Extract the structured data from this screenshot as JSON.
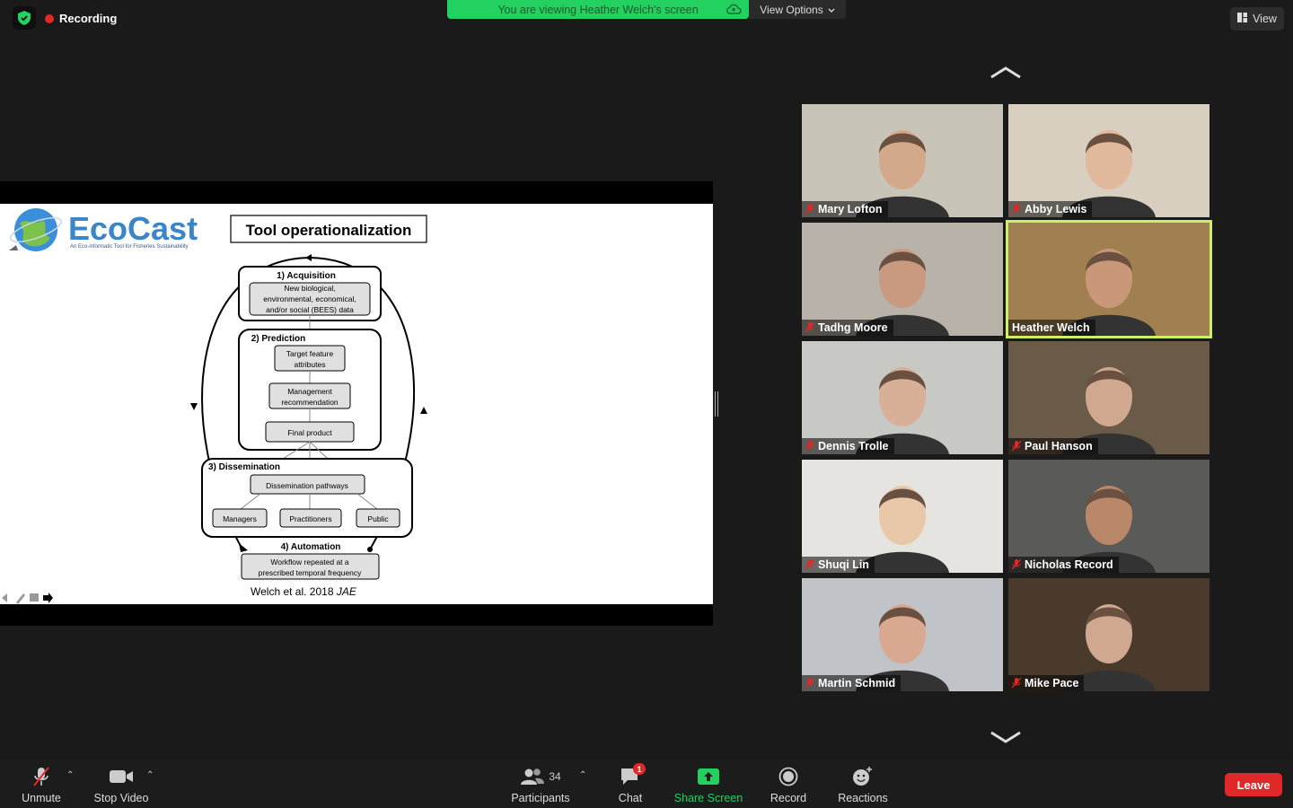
{
  "top": {
    "recording_label": "Recording",
    "banner_text": "You are viewing Heather Welch's screen",
    "view_options_label": "View Options",
    "view_label": "View"
  },
  "slide": {
    "logo_name": "EcoCast",
    "logo_tagline": "An Eco-informatic Tool for Fisheries Sustainability",
    "title": "Tool operationalization",
    "steps": {
      "acquisition": "1) Acquisition",
      "acquisition_box": [
        "New biological,",
        "environmental,  economical,",
        "and/or social (BEES) data"
      ],
      "prediction": "2) Prediction",
      "target_box": [
        "Target feature",
        "attributes"
      ],
      "management_box": [
        "Management",
        "recommendation"
      ],
      "final_box": "Final product",
      "dissemination": "3) Dissemination",
      "pathways_box": "Dissemination pathways",
      "managers": "Managers",
      "practitioners": "Practitioners",
      "public": "Public",
      "automation": "4) Automation",
      "workflow_box": [
        "Workflow  repeated at a",
        "prescribed temporal frequency"
      ]
    },
    "citation": "Welch et al. 2018",
    "citation_journal": "JAE"
  },
  "participants": [
    {
      "name": "Mary Lofton",
      "muted": true,
      "bg": "#c9c4b8",
      "face": "#d4a88a"
    },
    {
      "name": "Abby Lewis",
      "muted": true,
      "bg": "#d8cfc0",
      "face": "#e0b89c"
    },
    {
      "name": "Tadhg Moore",
      "muted": true,
      "bg": "#b8b2a8",
      "face": "#c99a80"
    },
    {
      "name": "Heather Welch",
      "muted": false,
      "bg": "#a08050",
      "face": "#c89878"
    },
    {
      "name": "Dennis Trolle",
      "muted": true,
      "bg": "#c8c8c4",
      "face": "#d8b098"
    },
    {
      "name": "Paul Hanson",
      "muted": true,
      "bg": "#6a5a48",
      "face": "#d0a890"
    },
    {
      "name": "Shuqi Lin",
      "muted": true,
      "bg": "#e6e4e0",
      "face": "#e8c8a8"
    },
    {
      "name": "Nicholas Record",
      "muted": true,
      "bg": "#5a5a58",
      "face": "#b88868"
    },
    {
      "name": "Martin Schmid",
      "muted": true,
      "bg": "#c0c4c8",
      "face": "#d8a890"
    },
    {
      "name": "Mike Pace",
      "muted": true,
      "bg": "#4a3a2c",
      "face": "#d0a890"
    }
  ],
  "toolbar": {
    "unmute": "Unmute",
    "stop_video": "Stop Video",
    "participants": "Participants",
    "participants_count": "34",
    "chat": "Chat",
    "chat_badge": "1",
    "share_screen": "Share Screen",
    "record": "Record",
    "reactions": "Reactions",
    "leave": "Leave"
  },
  "colors": {
    "banner_green": "#23d160",
    "share_green": "#23d160",
    "active_speaker": "#c8f06a",
    "leave_red": "#e02828"
  }
}
